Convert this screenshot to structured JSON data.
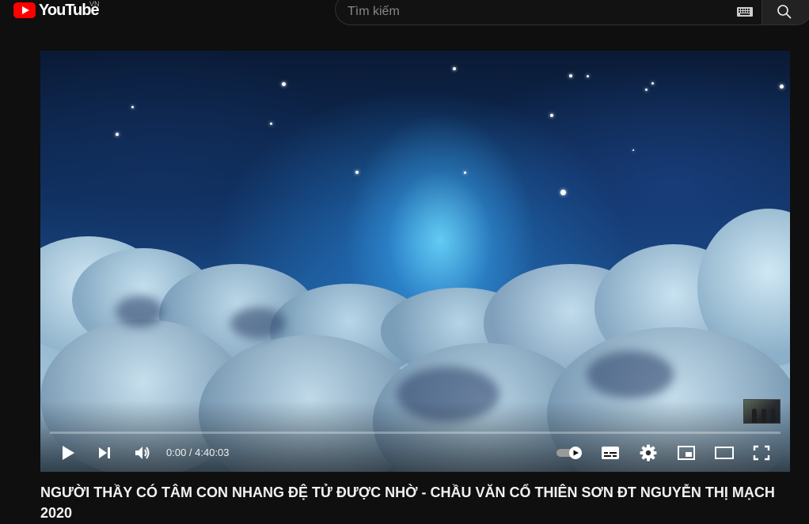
{
  "masthead": {
    "logo_text": "YouTube",
    "region_code": "VN",
    "search_placeholder": "Tìm kiếm"
  },
  "player": {
    "time_current": "0:00",
    "time_separator": " / ",
    "time_total": "4:40:03",
    "time_display": "0:00 / 4:40:03",
    "progress_fraction": 0.0,
    "autoplay_on": true,
    "icons": [
      "play-icon",
      "next-icon",
      "volume-icon",
      "autoplay-toggle-icon",
      "subtitles-icon",
      "settings-icon",
      "miniplayer-icon",
      "theater-mode-icon",
      "fullscreen-icon"
    ]
  },
  "video": {
    "title": "NGƯỜI THẦY CÓ TÂM CON NHANG ĐỆ TỬ ĐƯỢC NHỜ - CHẦU VĂN CỔ THIÊN SƠN ĐT NGUYỄN THỊ MẠCH 2020"
  },
  "colors": {
    "background": "#0f0f0f",
    "brand_red": "#ff0000",
    "text": "#f1f1f1"
  }
}
